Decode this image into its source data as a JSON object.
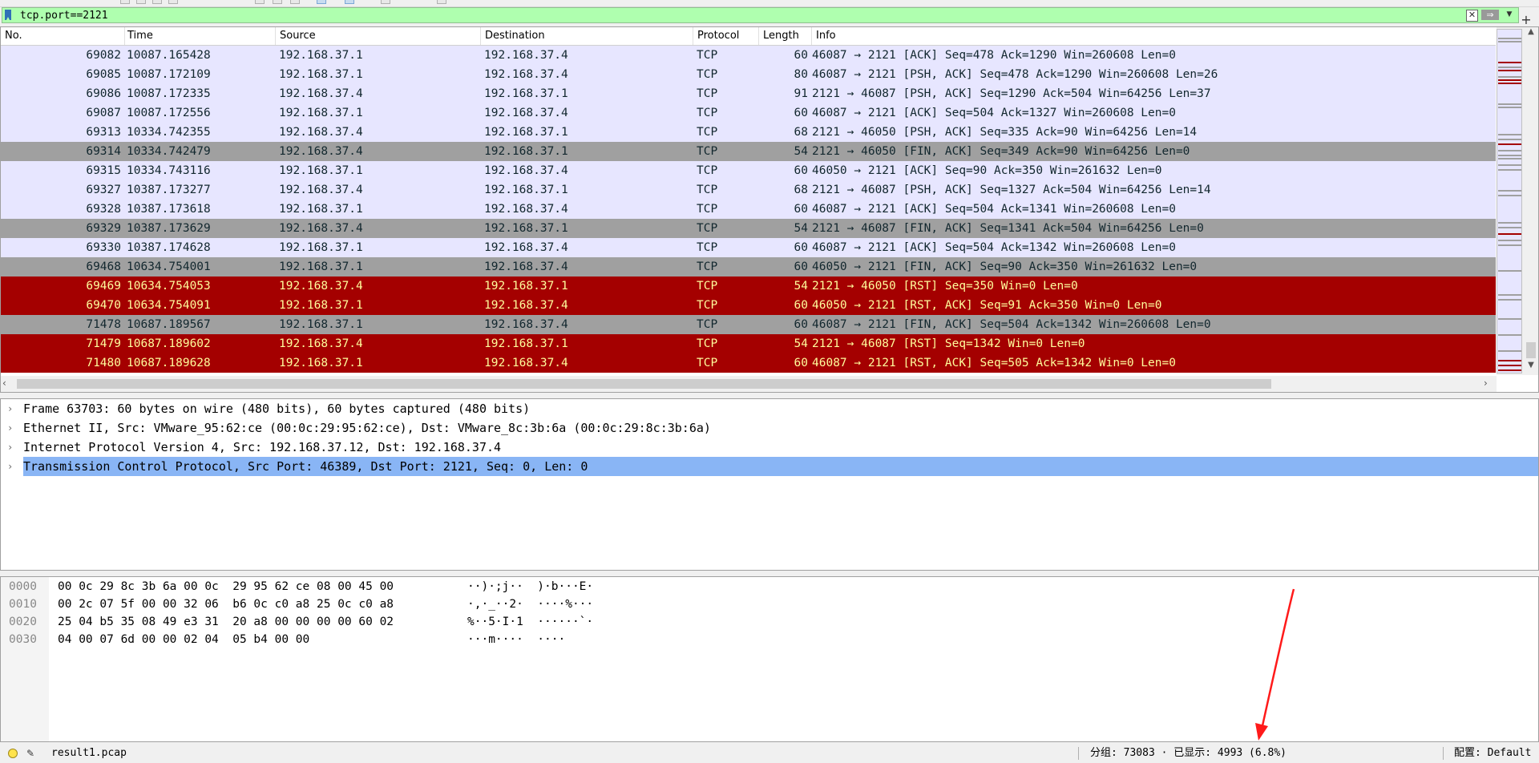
{
  "filter": {
    "value": "tcp.port==2121",
    "clear_icon": "clear-icon",
    "apply_icon": "arrow-right-icon",
    "recent_icon": "chevron-down-icon",
    "add_icon": "plus-icon"
  },
  "columns": [
    "No.",
    "Time",
    "Source",
    "Destination",
    "Protocol",
    "Length",
    "Info"
  ],
  "packets": [
    {
      "no": "69082",
      "time": "10087.165428",
      "src": "192.168.37.1",
      "dst": "192.168.37.4",
      "proto": "TCP",
      "len": "60",
      "info": "46087 → 2121 [ACK] Seq=478 Ack=1290 Win=260608 Len=0",
      "style": "normal"
    },
    {
      "no": "69085",
      "time": "10087.172109",
      "src": "192.168.37.1",
      "dst": "192.168.37.4",
      "proto": "TCP",
      "len": "80",
      "info": "46087 → 2121 [PSH, ACK] Seq=478 Ack=1290 Win=260608 Len=26",
      "style": "normal"
    },
    {
      "no": "69086",
      "time": "10087.172335",
      "src": "192.168.37.4",
      "dst": "192.168.37.1",
      "proto": "TCP",
      "len": "91",
      "info": "2121 → 46087 [PSH, ACK] Seq=1290 Ack=504 Win=64256 Len=37",
      "style": "normal"
    },
    {
      "no": "69087",
      "time": "10087.172556",
      "src": "192.168.37.1",
      "dst": "192.168.37.4",
      "proto": "TCP",
      "len": "60",
      "info": "46087 → 2121 [ACK] Seq=504 Ack=1327 Win=260608 Len=0",
      "style": "normal"
    },
    {
      "no": "69313",
      "time": "10334.742355",
      "src": "192.168.37.4",
      "dst": "192.168.37.1",
      "proto": "TCP",
      "len": "68",
      "info": "2121 → 46050 [PSH, ACK] Seq=335 Ack=90 Win=64256 Len=14",
      "style": "normal"
    },
    {
      "no": "69314",
      "time": "10334.742479",
      "src": "192.168.37.4",
      "dst": "192.168.37.1",
      "proto": "TCP",
      "len": "54",
      "info": "2121 → 46050 [FIN, ACK] Seq=349 Ack=90 Win=64256 Len=0",
      "style": "fin"
    },
    {
      "no": "69315",
      "time": "10334.743116",
      "src": "192.168.37.1",
      "dst": "192.168.37.4",
      "proto": "TCP",
      "len": "60",
      "info": "46050 → 2121 [ACK] Seq=90 Ack=350 Win=261632 Len=0",
      "style": "normal"
    },
    {
      "no": "69327",
      "time": "10387.173277",
      "src": "192.168.37.4",
      "dst": "192.168.37.1",
      "proto": "TCP",
      "len": "68",
      "info": "2121 → 46087 [PSH, ACK] Seq=1327 Ack=504 Win=64256 Len=14",
      "style": "normal"
    },
    {
      "no": "69328",
      "time": "10387.173618",
      "src": "192.168.37.1",
      "dst": "192.168.37.4",
      "proto": "TCP",
      "len": "60",
      "info": "46087 → 2121 [ACK] Seq=504 Ack=1341 Win=260608 Len=0",
      "style": "normal"
    },
    {
      "no": "69329",
      "time": "10387.173629",
      "src": "192.168.37.4",
      "dst": "192.168.37.1",
      "proto": "TCP",
      "len": "54",
      "info": "2121 → 46087 [FIN, ACK] Seq=1341 Ack=504 Win=64256 Len=0",
      "style": "fin"
    },
    {
      "no": "69330",
      "time": "10387.174628",
      "src": "192.168.37.1",
      "dst": "192.168.37.4",
      "proto": "TCP",
      "len": "60",
      "info": "46087 → 2121 [ACK] Seq=504 Ack=1342 Win=260608 Len=0",
      "style": "normal"
    },
    {
      "no": "69468",
      "time": "10634.754001",
      "src": "192.168.37.1",
      "dst": "192.168.37.4",
      "proto": "TCP",
      "len": "60",
      "info": "46050 → 2121 [FIN, ACK] Seq=90 Ack=350 Win=261632 Len=0",
      "style": "fin"
    },
    {
      "no": "69469",
      "time": "10634.754053",
      "src": "192.168.37.4",
      "dst": "192.168.37.1",
      "proto": "TCP",
      "len": "54",
      "info": "2121 → 46050 [RST] Seq=350 Win=0 Len=0",
      "style": "rst"
    },
    {
      "no": "69470",
      "time": "10634.754091",
      "src": "192.168.37.1",
      "dst": "192.168.37.4",
      "proto": "TCP",
      "len": "60",
      "info": "46050 → 2121 [RST, ACK] Seq=91 Ack=350 Win=0 Len=0",
      "style": "rst"
    },
    {
      "no": "71478",
      "time": "10687.189567",
      "src": "192.168.37.1",
      "dst": "192.168.37.4",
      "proto": "TCP",
      "len": "60",
      "info": "46087 → 2121 [FIN, ACK] Seq=504 Ack=1342 Win=260608 Len=0",
      "style": "fin"
    },
    {
      "no": "71479",
      "time": "10687.189602",
      "src": "192.168.37.4",
      "dst": "192.168.37.1",
      "proto": "TCP",
      "len": "54",
      "info": "2121 → 46087 [RST] Seq=1342 Win=0 Len=0",
      "style": "rst"
    },
    {
      "no": "71480",
      "time": "10687.189628",
      "src": "192.168.37.1",
      "dst": "192.168.37.4",
      "proto": "TCP",
      "len": "60",
      "info": "46087 → 2121 [RST, ACK] Seq=505 Ack=1342 Win=0 Len=0",
      "style": "rst"
    }
  ],
  "details": [
    {
      "text": "Frame 63703: 60 bytes on wire (480 bits), 60 bytes captured (480 bits)",
      "selected": false
    },
    {
      "text": "Ethernet II, Src: VMware_95:62:ce (00:0c:29:95:62:ce), Dst: VMware_8c:3b:6a (00:0c:29:8c:3b:6a)",
      "selected": false
    },
    {
      "text": "Internet Protocol Version 4, Src: 192.168.37.12, Dst: 192.168.37.4",
      "selected": false
    },
    {
      "text": "Transmission Control Protocol, Src Port: 46389, Dst Port: 2121, Seq: 0, Len: 0",
      "selected": true
    }
  ],
  "bytes": [
    {
      "offset": "0000",
      "hex": "00 0c 29 8c 3b 6a 00 0c  29 95 62 ce 08 00 45 00",
      "ascii": "··)·;j··  )·b···E·"
    },
    {
      "offset": "0010",
      "hex": "00 2c 07 5f 00 00 32 06  b6 0c c0 a8 25 0c c0 a8",
      "ascii": "·,·_··2·  ····%···"
    },
    {
      "offset": "0020",
      "hex": "25 04 b5 35 08 49 e3 31  20 a8 00 00 00 00 60 02",
      "ascii": "%··5·I·1  ······`·"
    },
    {
      "offset": "0030",
      "hex": "04 00 07 6d 00 00 02 04  05 b4 00 00",
      "ascii": "···m····  ····"
    }
  ],
  "status": {
    "filename": "result1.pcap",
    "stats": "分组: 73083 · 已显示: 4993 (6.8%)",
    "profile": "配置: Default"
  },
  "colors": {
    "normal_row": "#e7e6ff",
    "fin_row": "#a0a0a0",
    "rst_row": "#a40000",
    "rst_text": "#fffc9c",
    "selected_detail": "#89b5f5",
    "filter_valid": "#afffaf",
    "annotation_arrow": "#ff1a1a"
  }
}
